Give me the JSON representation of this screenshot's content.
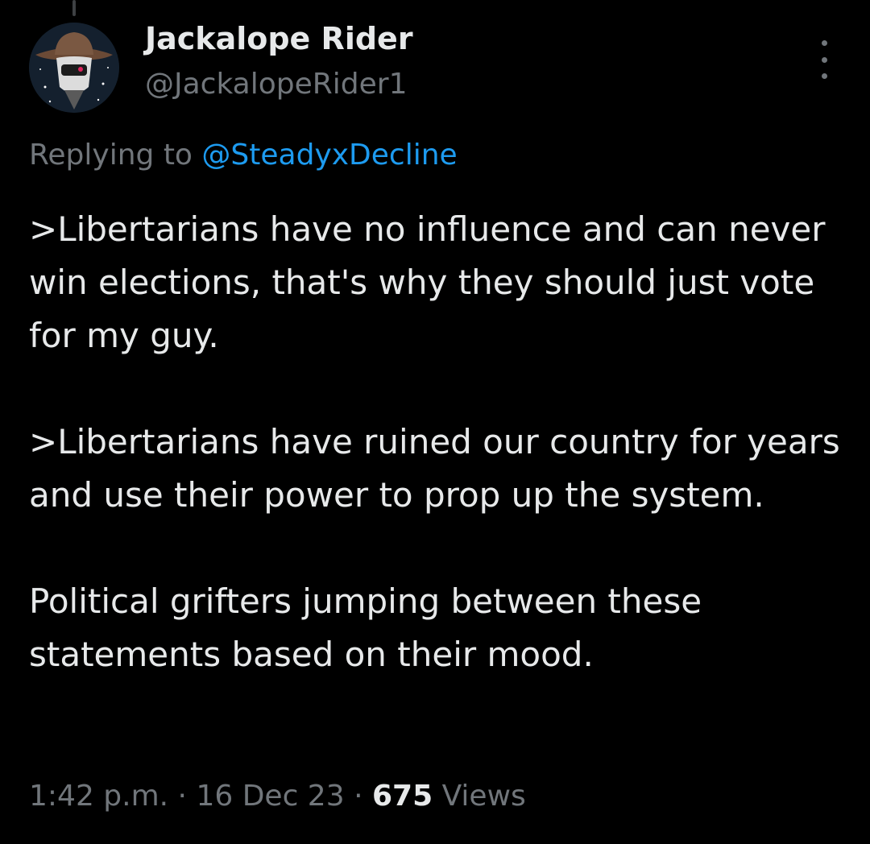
{
  "tweet": {
    "author": {
      "display_name": "Jackalope Rider",
      "handle": "@JackalopeRider1",
      "avatar_icon": "cowboy-helmet-avatar"
    },
    "reply": {
      "prefix": "Replying to",
      "mention": "@SteadyxDecline"
    },
    "body": {
      "paragraph_1": ">Libertarians have no influence and can never win elections, that's why they should just vote for my guy.",
      "paragraph_2": ">Libertarians have ruined our country for years and use their power to prop up the system.",
      "paragraph_3": "Political grifters jumping between these statements based on their mood."
    },
    "meta": {
      "time": "1:42 p.m.",
      "separator": "·",
      "date": "16 Dec 23",
      "views_count": "675",
      "views_label": "Views"
    },
    "more_icon": "more-vertical-icon"
  },
  "colors": {
    "background": "#000000",
    "primary_text": "#e7e9ea",
    "secondary_text": "#71767b",
    "link": "#1d9bf0"
  }
}
